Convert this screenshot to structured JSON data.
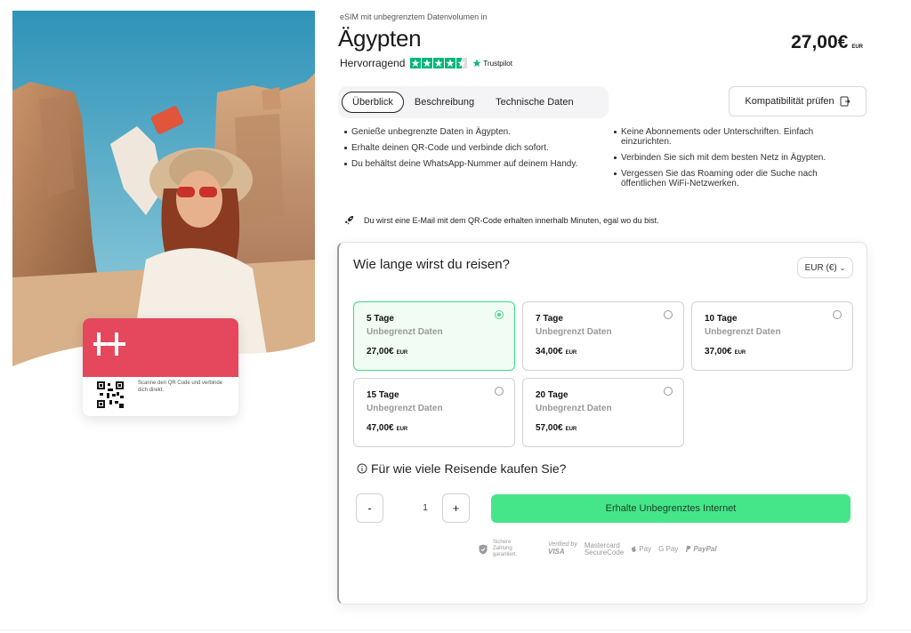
{
  "header": {
    "eyebrow": "eSIM mit unbegrenztem Datenvolumen in",
    "title": "Ägypten",
    "rating_label": "Hervorragend",
    "trustpilot_label": "Trustpilot",
    "stars_rating": 4.5,
    "price": "27,00€",
    "price_currency": "EUR"
  },
  "hero": {
    "qr_text": "Scanne den QR Code und verbinde dich direkt."
  },
  "tabs": [
    {
      "label": "Überblick",
      "active": true
    },
    {
      "label": "Beschreibung",
      "active": false
    },
    {
      "label": "Technische Daten",
      "active": false
    }
  ],
  "compat_button": {
    "label": "Kompatibilität prüfen"
  },
  "bullets_left": [
    "Genieße unbegrenzte Daten in Ägypten.",
    "Erhalte deinen QR-Code und verbinde dich sofort.",
    "Du behältst deine WhatsApp-Nummer auf deinem Handy."
  ],
  "bullets_right": [
    "Keine Abonnements oder Unterschriften. Einfach einzurichten.",
    "Verbinden Sie sich mit dem besten Netz in Ägypten.",
    "Vergessen Sie das Roaming oder die Suche nach öffentlichen WiFi-Netzwerken."
  ],
  "email_note": "Du wirst eine E-Mail mit dem QR-Code erhalten innerhalb Minuten, egal wo du bist.",
  "booking": {
    "question_trip": "Wie lange wirst du reisen?",
    "currency_select": "EUR (€)",
    "plans": [
      {
        "days": "5 Tage",
        "data": "Unbegrenzt Daten",
        "price": "27,00€",
        "currency": "EUR",
        "selected": true
      },
      {
        "days": "7 Tage",
        "data": "Unbegrenzt Daten",
        "price": "34,00€",
        "currency": "EUR",
        "selected": false
      },
      {
        "days": "10 Tage",
        "data": "Unbegrenzt Daten",
        "price": "37,00€",
        "currency": "EUR",
        "selected": false
      },
      {
        "days": "15 Tage",
        "data": "Unbegrenzt Daten",
        "price": "47,00€",
        "currency": "EUR",
        "selected": false
      },
      {
        "days": "20 Tage",
        "data": "Unbegrenzt Daten",
        "price": "57,00€",
        "currency": "EUR",
        "selected": false
      }
    ],
    "question_travelers": "Für wie viele Reisende kaufen Sie?",
    "minus_label": "-",
    "plus_label": "+",
    "quantity": "1",
    "cta_label": "Erhalte Unbegrenztes Internet"
  },
  "payments": {
    "secure_text": "Sichere Zahlung garantiert.",
    "verified_by": "Verified by",
    "visa": "VISA",
    "mastercard": "Mastercard",
    "securecode": "SecureCode",
    "apple_pay": "Pay",
    "google_pay": "G Pay",
    "paypal": "PayPal"
  },
  "colors": {
    "accent_green": "#45e68a",
    "selected_border": "#3ddc84",
    "brand_red": "#e5475c",
    "trustpilot_green": "#00b67a"
  }
}
